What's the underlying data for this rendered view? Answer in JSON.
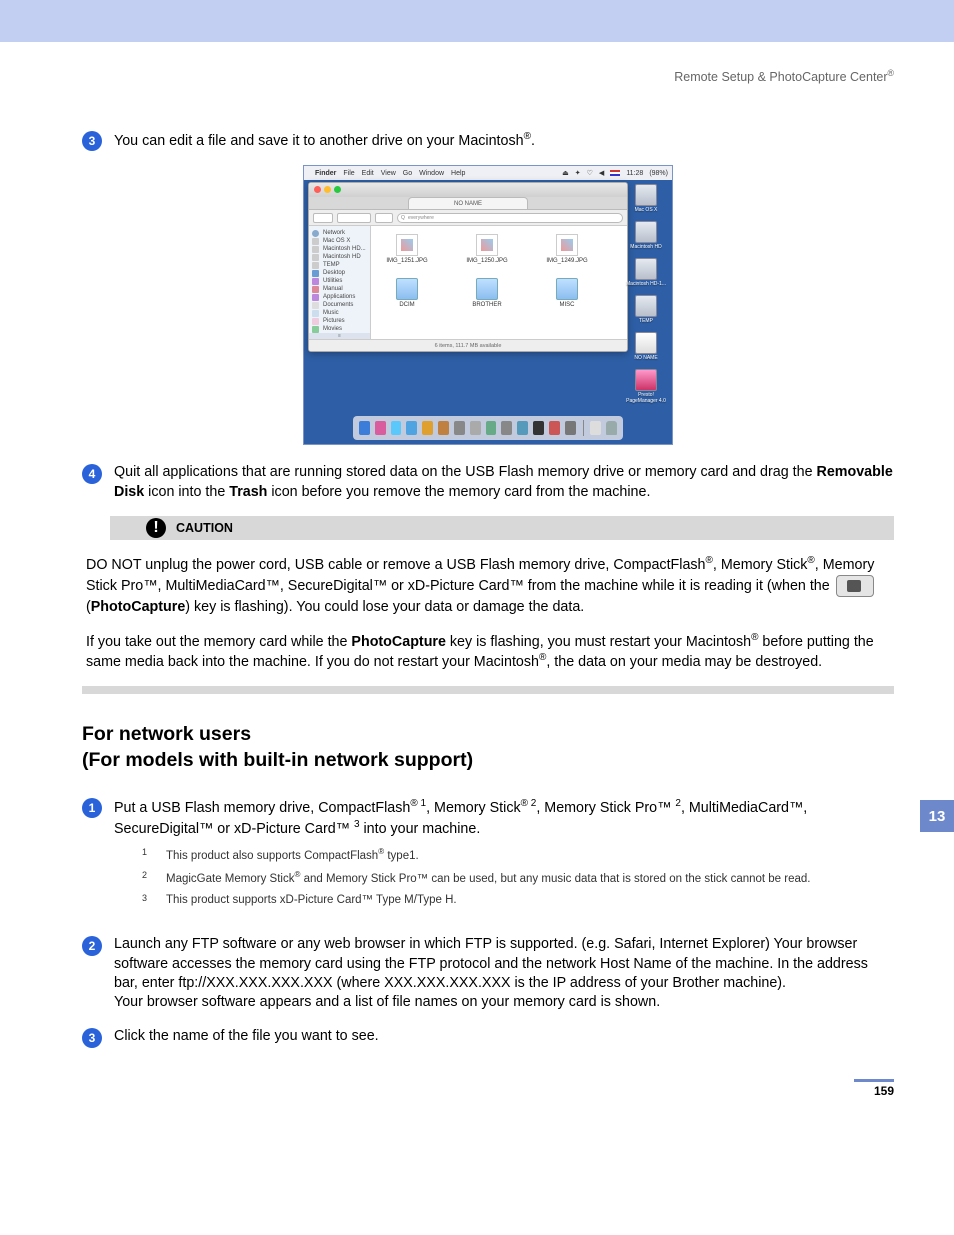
{
  "header": {
    "title": "Remote Setup & PhotoCapture Center",
    "reg": "®"
  },
  "step3": {
    "num": "3",
    "text_a": "You can edit a file and save it to another drive on your Macintosh",
    "reg": "®",
    "text_b": "."
  },
  "screenshot": {
    "menubar": {
      "apple": "",
      "items": [
        "Finder",
        "File",
        "Edit",
        "View",
        "Go",
        "Window",
        "Help"
      ],
      "time": "11:28",
      "batt": "(98%)"
    },
    "window_title": "NO NAME",
    "search_placeholder": "everywhere",
    "sidebar": [
      "Network",
      "Mac OS X",
      "Macintosh HD...",
      "Macintosh HD",
      "TEMP",
      "Desktop",
      "Utilities",
      "Manual",
      "Applications",
      "Documents",
      "Music",
      "Pictures",
      "Movies"
    ],
    "files": [
      {
        "name": "IMG_1251.JPG",
        "type": "jpg"
      },
      {
        "name": "IMG_1250.JPG",
        "type": "jpg"
      },
      {
        "name": "IMG_1249.JPG",
        "type": "jpg"
      },
      {
        "name": "DCIM",
        "type": "folder"
      },
      {
        "name": "BROTHER",
        "type": "folder"
      },
      {
        "name": "MISC",
        "type": "folder"
      }
    ],
    "status": "6 items, 111.7 MB available",
    "desktop": [
      "Mac OS X",
      "Macintosh HD",
      "Macintosh HD-1...",
      "TEMP",
      "NO NAME",
      "Presto! PageManager 4.0"
    ]
  },
  "step4": {
    "num": "4",
    "t1": "Quit all applications that are running stored data on the USB Flash memory drive or memory card and drag the ",
    "b1": "Removable Disk",
    "t2": " icon into the ",
    "b2": "Trash",
    "t3": " icon before you remove the memory card from the machine."
  },
  "caution": {
    "label": "CAUTION",
    "p1a": "DO NOT unplug the power cord, USB cable or remove a USB Flash memory drive, CompactFlash",
    "p1b": ", Memory Stick",
    "p1c": ", Memory Stick Pro™, MultiMediaCard™, SecureDigital™ or xD-Picture Card™ from the machine while it is reading it (when the ",
    "p1d": " (",
    "p1bold": "PhotoCapture",
    "p1e": ") key is flashing). You could lose your data or damage the data.",
    "p2a": "If you take out the memory card while the ",
    "p2bold": "PhotoCapture",
    "p2b": " key is flashing, you must restart your Macintosh",
    "p2c": " before putting the same media back into the machine. If you do not restart your Macintosh",
    "p2d": ", the data on your media may be destroyed."
  },
  "section2": {
    "title_l1": "For network users",
    "title_l2": "(For models with built-in network support)"
  },
  "side_tab": "13",
  "nstep1": {
    "num": "1",
    "t1": "Put a USB Flash memory drive, CompactFlash",
    "s1": "1",
    "t2": ", Memory Stick",
    "s2": "2",
    "t3": ", Memory Stick Pro™ ",
    "s3": "2",
    "t4": ", MultiMediaCard™, SecureDigital™ or xD-Picture Card™ ",
    "s4": "3",
    "t5": " into your machine."
  },
  "footnotes": {
    "f1n": "1",
    "f1a": "This product also supports CompactFlash",
    "f1b": " type1.",
    "f2n": "2",
    "f2a": "MagicGate Memory Stick",
    "f2b": " and Memory Stick Pro™ can be used, but any music data that is stored on the stick cannot be read.",
    "f3n": "3",
    "f3": "This product supports xD-Picture Card™ Type M/Type H."
  },
  "nstep2": {
    "num": "2",
    "t": "Launch any FTP software or any web browser in which FTP is supported. (e.g. Safari, Internet Explorer) Your browser software accesses the memory card using the FTP protocol and the network Host Name of the machine. In the address bar, enter ftp://XXX.XXX.XXX.XXX (where XXX.XXX.XXX.XXX is the IP address of your Brother machine).",
    "t2": "Your browser software appears and a list of file names on your memory card is shown."
  },
  "nstep3": {
    "num": "3",
    "t": "Click the name of the file you want to see."
  },
  "page_num": "159"
}
